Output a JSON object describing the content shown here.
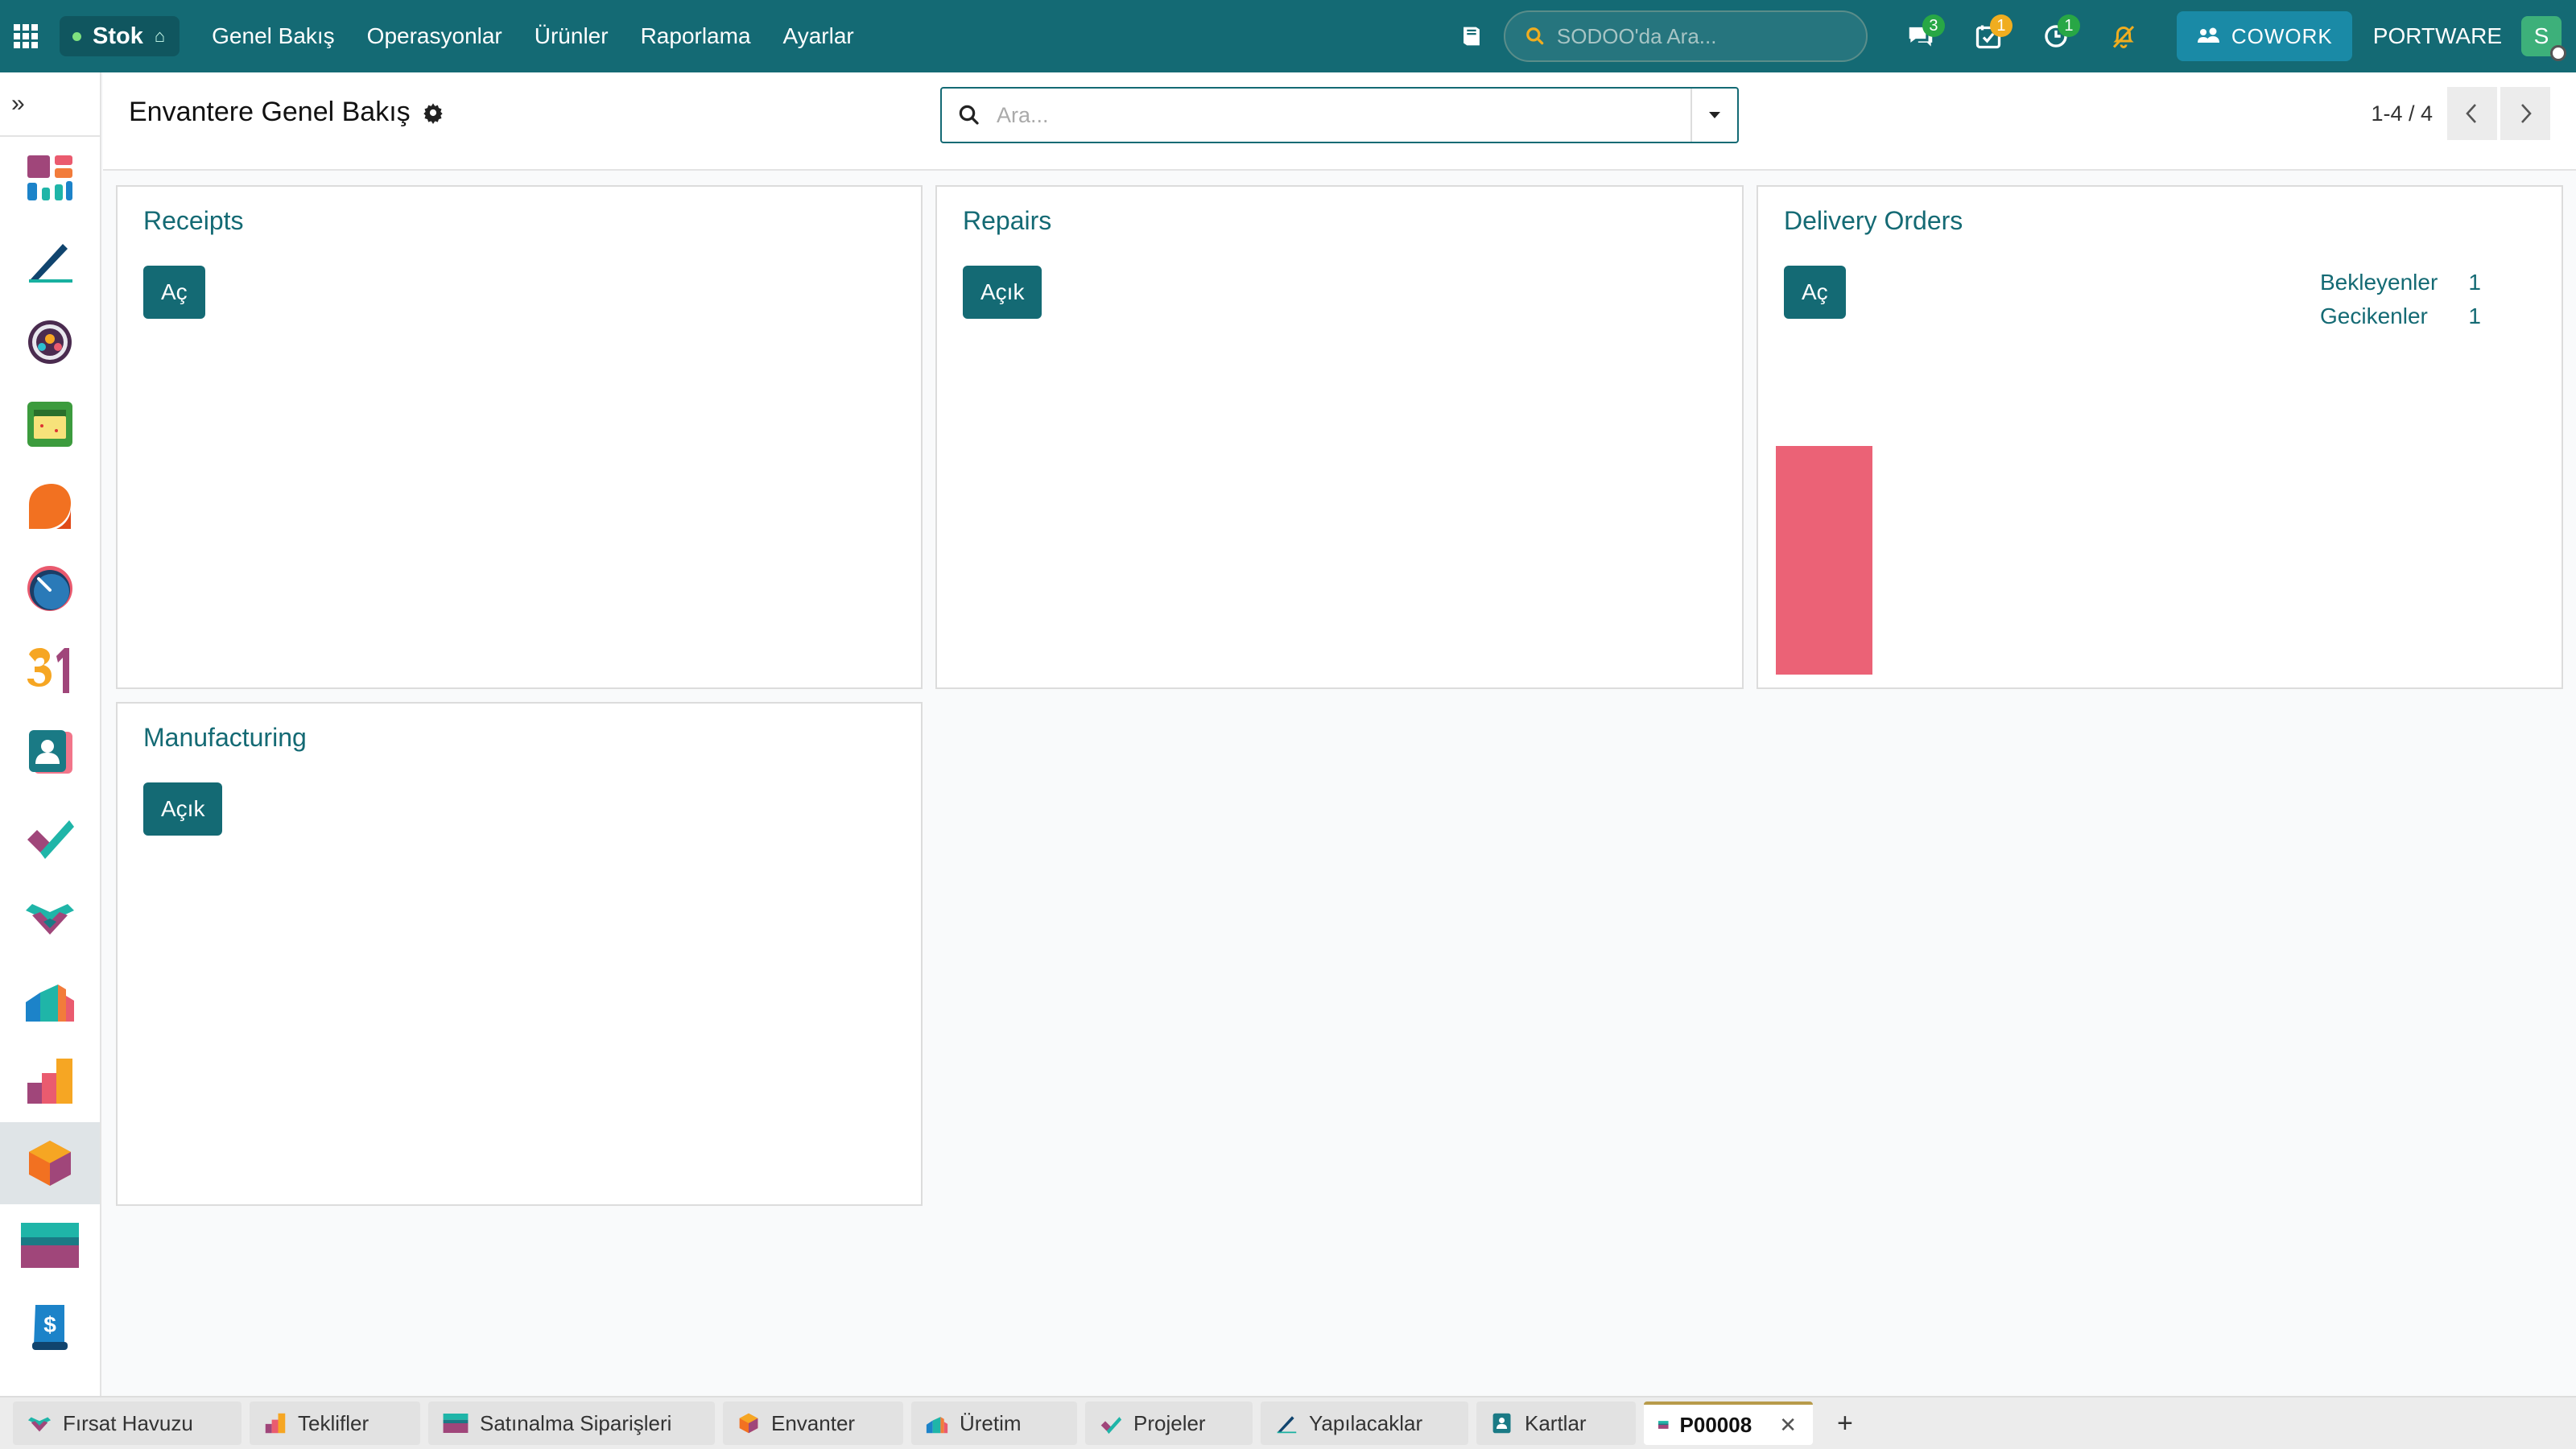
{
  "navbar": {
    "app_name": "Stok",
    "menu": [
      "Genel Bakış",
      "Operasyonlar",
      "Ürünler",
      "Raporlama",
      "Ayarlar"
    ],
    "search_placeholder": "SODOO'da Ara...",
    "messages_count": "3",
    "activities_count": "1",
    "timer_count": "1",
    "cowork_label": "COWORK",
    "company": "PORTWARE",
    "avatar_letter": "S"
  },
  "control_panel": {
    "title": "Envantere Genel Bakış",
    "search_placeholder": "Ara...",
    "pager": "1-4 / 4"
  },
  "cards": [
    {
      "title": "Receipts",
      "button": "Aç"
    },
    {
      "title": "Repairs",
      "button": "Açık"
    },
    {
      "title": "Delivery Orders",
      "button": "Aç",
      "stats": [
        {
          "label": "Bekleyenler",
          "value": "1"
        },
        {
          "label": "Gecikenler",
          "value": "1"
        }
      ]
    },
    {
      "title": "Manufacturing",
      "button": "Açık"
    }
  ],
  "sidebar_apps": [
    "dashboard-icon",
    "notes-pen-icon",
    "members-circle-icon",
    "calendar-board-icon",
    "orange-leaf-icon",
    "gauge-icon",
    "calendar-31-icon",
    "contacts-icon",
    "project-check-icon",
    "crm-handshake-icon",
    "manufacturing-icon",
    "sales-chart-icon",
    "inventory-box-icon",
    "purchase-card-icon",
    "invoice-dollar-icon"
  ],
  "bottom_tabs": [
    {
      "label": "Fırsat Havuzu"
    },
    {
      "label": "Teklifler"
    },
    {
      "label": "Satınalma Siparişleri"
    },
    {
      "label": "Envanter"
    },
    {
      "label": "Üretim"
    },
    {
      "label": "Projeler"
    },
    {
      "label": "Yapılacaklar"
    },
    {
      "label": "Kartlar"
    },
    {
      "label": "P00008",
      "active": true
    }
  ],
  "colors": {
    "primary": "#146a74",
    "graph_bar": "#eb6276",
    "badge_green": "#28a745",
    "badge_amber": "#f0ad1f",
    "cowork": "#1a8aa6"
  }
}
